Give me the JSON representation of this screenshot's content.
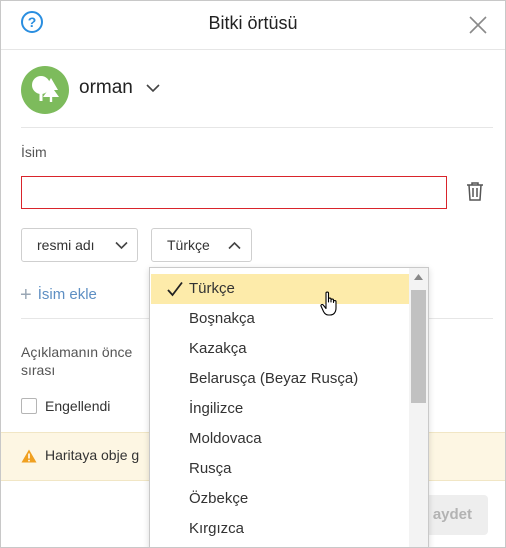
{
  "header": {
    "title": "Bitki örtüsü",
    "help_icon": "?",
    "close_icon": "close-icon"
  },
  "category": {
    "label": "orman",
    "icon": "trees-icon",
    "icon_color": "#7dbb5c"
  },
  "name_field": {
    "label": "İsim",
    "value": "",
    "border_color": "#d9242b"
  },
  "type_select": {
    "selected": "resmi adı"
  },
  "lang_select": {
    "selected": "Türkçe"
  },
  "add_name": {
    "label": "İsim ekle"
  },
  "description": {
    "label": "Açıklamanın önce sırası"
  },
  "blocked": {
    "label": "Engellendi",
    "checked": false
  },
  "warning": {
    "text": "Haritaya obje g"
  },
  "save": {
    "label": "aydet"
  },
  "dropdown": {
    "options": [
      {
        "label": "Türkçe",
        "selected": true
      },
      {
        "label": "Boşnakça",
        "selected": false
      },
      {
        "label": "Kazakça",
        "selected": false
      },
      {
        "label": "Belarusça (Beyaz Rusça)",
        "selected": false
      },
      {
        "label": "İngilizce",
        "selected": false
      },
      {
        "label": "Moldovaca",
        "selected": false
      },
      {
        "label": "Rusça",
        "selected": false
      },
      {
        "label": "Özbekçe",
        "selected": false
      },
      {
        "label": "Kırgızca",
        "selected": false
      }
    ]
  },
  "colors": {
    "accent": "#2a8ee0",
    "link": "#5e8fc3",
    "selected_option": "#fdebaa",
    "warning_bg": "#fdf6e3"
  }
}
